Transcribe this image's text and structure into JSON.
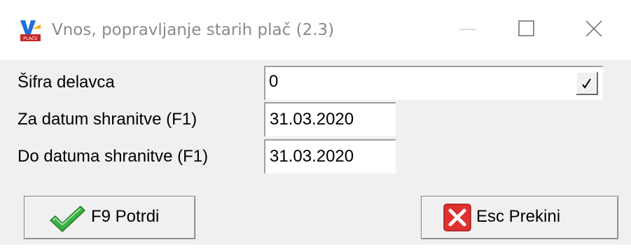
{
  "window": {
    "title": "Vnos, popravljanje starih plač  (2.3)",
    "app_icon_text": "PLAČE"
  },
  "form": {
    "employee_code": {
      "label": "Šifra delavca",
      "value": "0",
      "dropdown_glyph": "✓"
    },
    "date_from": {
      "label": "Za datum shranitve (F1)",
      "value": "31.03.2020"
    },
    "date_to": {
      "label": "Do datuma shranitve (F1)",
      "value": "31.03.2020"
    }
  },
  "buttons": {
    "confirm": {
      "label": "F9 Potrdi",
      "icon": "green-checkmark-icon"
    },
    "cancel": {
      "label": "Esc Prekini",
      "icon": "red-x-icon"
    }
  },
  "colors": {
    "titlebar_bg": "#ffffff",
    "dialog_bg": "#f0f0f0",
    "confirm_icon": "#3cb043",
    "cancel_icon": "#e03030"
  }
}
